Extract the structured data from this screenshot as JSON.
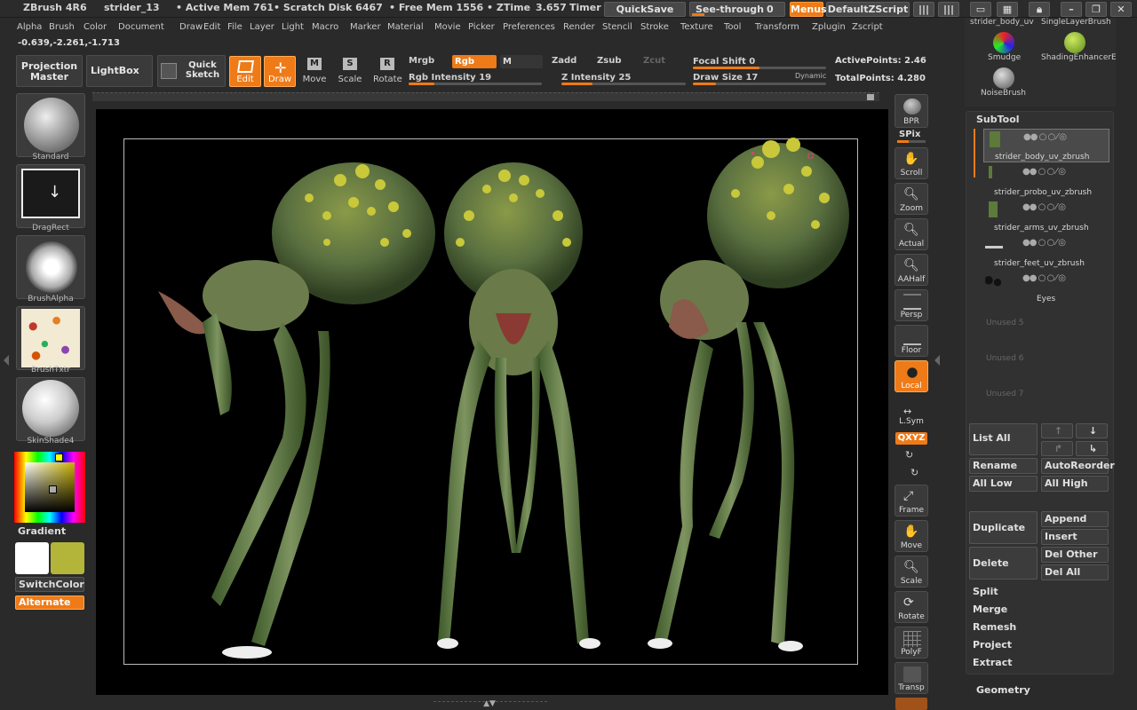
{
  "title_bar": {
    "app": "ZBrush 4R6",
    "doc": "strider_13",
    "active_mem": "• Active Mem 761",
    "scratch": "• Scratch Disk 6467",
    "free_mem": "• Free Mem 1556",
    "ztime": "• ZTime",
    "ztime_value": "3.657",
    "timer": "Timer",
    "quicksave": "QuickSave",
    "see_through": "See-through",
    "see_through_value": "0",
    "menus": "Menus",
    "script": "DefaultZScript"
  },
  "menu_items": [
    "Alpha",
    "Brush",
    "Color",
    "Document",
    "Draw",
    "Edit",
    "File",
    "Layer",
    "Light",
    "Macro",
    "Marker",
    "Material",
    "Movie",
    "Picker",
    "Preferences",
    "Render",
    "Stencil",
    "Stroke",
    "Texture",
    "Tool",
    "Transform",
    "Zplugin",
    "Zscript"
  ],
  "coords": "-0.639,-2.261,-1.713",
  "toolbar": {
    "projection_master": "Projection Master",
    "lightbox": "LightBox",
    "quick_sketch": "Quick Sketch",
    "edit": "Edit",
    "draw": "Draw",
    "move": "Move",
    "scale": "Scale",
    "rotate": "Rotate",
    "mrgb": "Mrgb",
    "rgb": "Rgb",
    "m": "M",
    "zadd": "Zadd",
    "zsub": "Zsub",
    "zcut": "Zcut",
    "rgb_intensity_label": "Rgb Intensity",
    "rgb_intensity": "19",
    "z_intensity_label": "Z Intensity",
    "z_intensity": "25",
    "focal_shift_label": "Focal Shift",
    "focal_shift": "0",
    "draw_size_label": "Draw Size",
    "draw_size": "17",
    "dynamic": "Dynamic",
    "active_points_label": "ActivePoints:",
    "active_points": "2.46",
    "total_points_label": "TotalPoints:",
    "total_points": "4.280"
  },
  "left_panel": {
    "standard": "Standard",
    "dragrect": "DragRect",
    "brush_alpha": "BrushAlpha",
    "brush_txtr": "BrushTxtr",
    "skinshade": "SkinShade4",
    "gradient": "Gradient",
    "switch_color": "SwitchColor",
    "alternate": "Alternate",
    "main_color": "#ffffff",
    "secondary_color": "#b3b53a"
  },
  "right_strip": {
    "bpr": "BPR",
    "spix": "SPix",
    "scroll": "Scroll",
    "zoom": "Zoom",
    "actual": "Actual",
    "aahalf": "AAHalf",
    "persp": "Persp",
    "floor": "Floor",
    "local": "Local",
    "lsym": "L.Sym",
    "xyz": "QXYZ",
    "frame": "Frame",
    "move": "Move",
    "scale": "Scale",
    "rotate": "Rotate",
    "polyf": "PolyF",
    "transp": "Transp"
  },
  "brushes": {
    "top_left": "strider_body_uv",
    "top_right": "SingleLayerBrush",
    "smudge": "Smudge",
    "shading": "ShadingEnhancerE",
    "noise": "NoiseBrush"
  },
  "subtool": {
    "header": "SubTool",
    "items": [
      "strider_body_uv_zbrush",
      "strider_probo_uv_zbrush",
      "strider_arms_uv_zbrush",
      "strider_feet_uv_zbrush",
      "Eyes"
    ],
    "unused": [
      "Unused 5",
      "Unused 6",
      "Unused 7"
    ],
    "list_all": "List All",
    "rename": "Rename",
    "auto_reorder": "AutoReorder",
    "all_low": "All Low",
    "all_high": "All High",
    "duplicate": "Duplicate",
    "append": "Append",
    "insert": "Insert",
    "delete": "Delete",
    "del_other": "Del Other",
    "del_all": "Del All",
    "split": "Split",
    "merge": "Merge",
    "remesh": "Remesh",
    "project": "Project",
    "extract": "Extract",
    "geometry": "Geometry"
  }
}
